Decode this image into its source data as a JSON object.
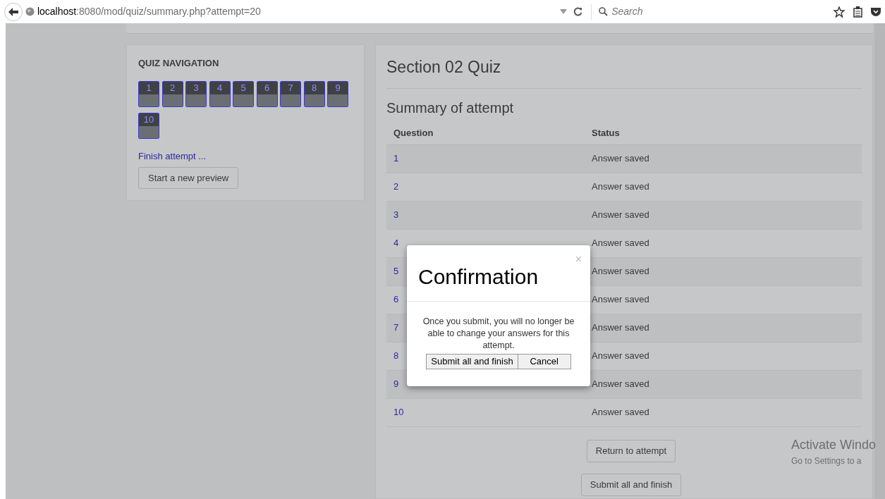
{
  "browser": {
    "url_host": "localhost",
    "url_path": ":8080/mod/quiz/summary.php?attempt=20",
    "search_placeholder": "Search"
  },
  "quiz_navigation": {
    "title": "QUIZ NAVIGATION",
    "buttons": [
      {
        "label": "1"
      },
      {
        "label": "2"
      },
      {
        "label": "3"
      },
      {
        "label": "4"
      },
      {
        "label": "5"
      },
      {
        "label": "6"
      },
      {
        "label": "7"
      },
      {
        "label": "8"
      },
      {
        "label": "9"
      },
      {
        "label": "10"
      }
    ],
    "finish_link": "Finish attempt ...",
    "new_preview_button": "Start a new preview"
  },
  "main": {
    "title": "Section 02 Quiz",
    "subtitle": "Summary of attempt",
    "table": {
      "columns": [
        "Question",
        "Status"
      ],
      "rows": [
        {
          "question": "1",
          "status": "Answer saved"
        },
        {
          "question": "2",
          "status": "Answer saved"
        },
        {
          "question": "3",
          "status": "Answer saved"
        },
        {
          "question": "4",
          "status": "Answer saved"
        },
        {
          "question": "5",
          "status": "Answer saved"
        },
        {
          "question": "6",
          "status": "Answer saved"
        },
        {
          "question": "7",
          "status": "Answer saved"
        },
        {
          "question": "8",
          "status": "Answer saved"
        },
        {
          "question": "9",
          "status": "Answer saved"
        },
        {
          "question": "10",
          "status": "Answer saved"
        }
      ]
    },
    "buttons": [
      "Return to attempt",
      "Submit all and finish"
    ]
  },
  "dialog": {
    "title": "Confirmation",
    "close": "×",
    "message": "Once you submit, you will no longer be able to change your answers for this attempt.",
    "buttons": [
      "Submit all and finish",
      "Cancel"
    ]
  },
  "os_notice": {
    "title": "Activate Windo",
    "subtitle": "Go to Settings to a"
  }
}
